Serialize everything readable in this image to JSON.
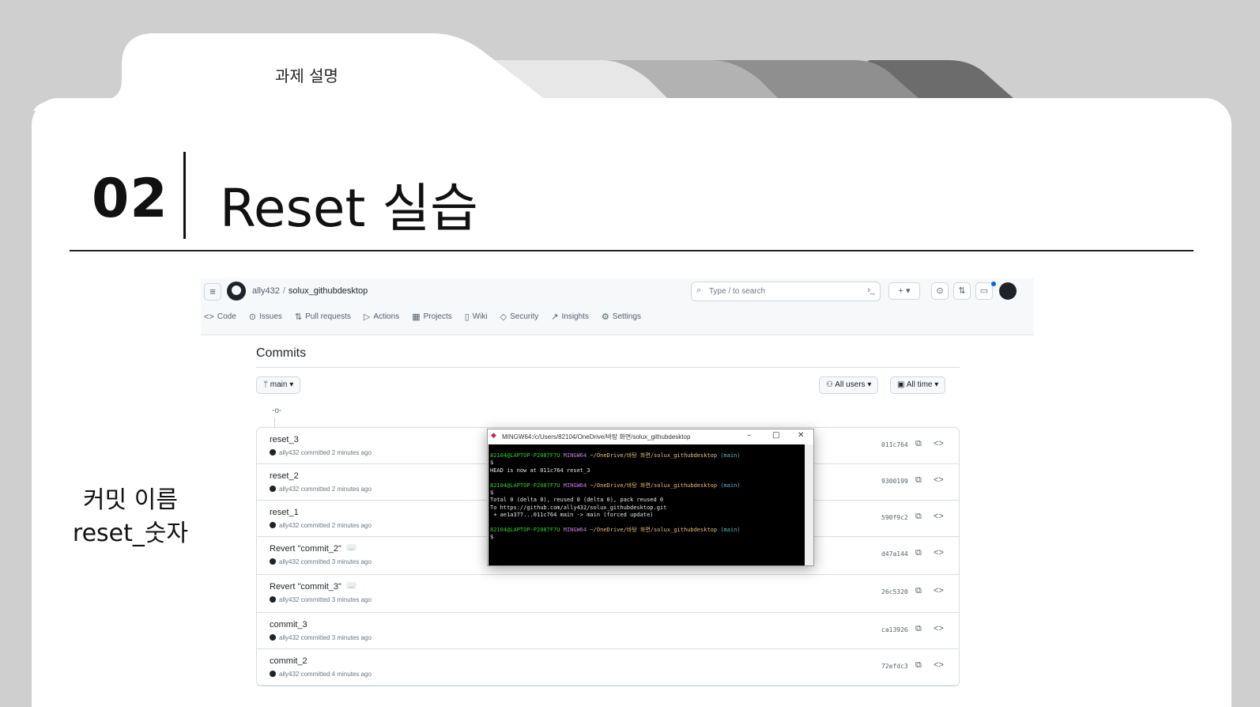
{
  "slide": {
    "tab_label": "과제 설명",
    "section_number": "02",
    "section_title": "Reset 실습",
    "side_note_line1": "커밋 이름",
    "side_note_line2": "reset_숫자"
  },
  "github": {
    "owner": "ally432",
    "repo_separator": "/",
    "repo": "solux_githubdesktop",
    "search_placeholder": "Type / to search",
    "nav": [
      {
        "label": "Code",
        "icon": "code-icon"
      },
      {
        "label": "Issues",
        "icon": "issue-icon"
      },
      {
        "label": "Pull requests",
        "icon": "pull-request-icon"
      },
      {
        "label": "Actions",
        "icon": "play-icon"
      },
      {
        "label": "Projects",
        "icon": "table-icon"
      },
      {
        "label": "Wiki",
        "icon": "book-icon"
      },
      {
        "label": "Security",
        "icon": "shield-icon"
      },
      {
        "label": "Insights",
        "icon": "graph-icon"
      },
      {
        "label": "Settings",
        "icon": "gear-icon"
      }
    ],
    "page_title": "Commits",
    "branch": "main",
    "filter_users": "All users",
    "filter_time": "All time",
    "commits": [
      {
        "message": "reset_3",
        "meta": "ally432 committed 2 minutes ago",
        "sha": "011c764",
        "badge": ""
      },
      {
        "message": "reset_2",
        "meta": "ally432 committed 2 minutes ago",
        "sha": "9300199",
        "badge": ""
      },
      {
        "message": "reset_1",
        "meta": "ally432 committed 2 minutes ago",
        "sha": "590f9c2",
        "badge": ""
      },
      {
        "message": "Revert \"commit_2\"",
        "meta": "ally432 committed 3 minutes ago",
        "sha": "d47a144",
        "badge": "..."
      },
      {
        "message": "Revert \"commit_3\"",
        "meta": "ally432 committed 3 minutes ago",
        "sha": "26c5320",
        "badge": "..."
      },
      {
        "message": "commit_3",
        "meta": "ally432 committed 3 minutes ago",
        "sha": "ca13926",
        "badge": ""
      },
      {
        "message": "commit_2",
        "meta": "ally432 committed 4 minutes ago",
        "sha": "72efdc3",
        "badge": ""
      }
    ]
  },
  "terminal": {
    "title": "MINGW64:/c/Users/82104/OneDrive/바탕 화면/solux_githubdesktop",
    "prompt_user": "82104@LAPTOP-P2087F7U",
    "prompt_env": "MINGW64",
    "prompt_path": "~/OneDrive/바탕 화면/solux_githubdesktop",
    "prompt_branch": "(main)",
    "line_dollar": "$",
    "line_head": "HEAD is now at 011c764 reset_3",
    "line_total": "Total 0 (delta 0), reused 0 (delta 0), pack reused 0",
    "line_to": "To https://github.com/ally432/solux_githubdesktop.git",
    "line_forced": " + ae1a377...011c764 main -> main (forced update)"
  }
}
